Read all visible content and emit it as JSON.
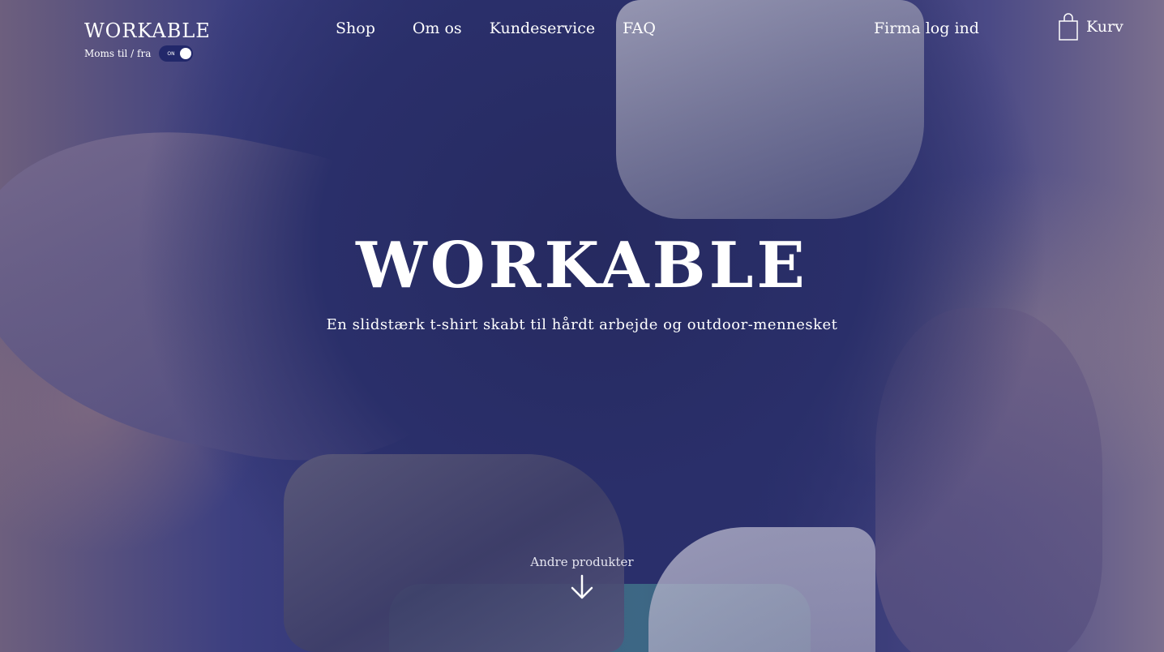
{
  "header": {
    "logo": "WORKABLE",
    "vat_label": "Moms til / fra",
    "vat_toggle_state": "ON",
    "nav": [
      {
        "label": "Shop"
      },
      {
        "label": "Om os"
      },
      {
        "label": "Kundeservice"
      },
      {
        "label": "FAQ"
      }
    ],
    "firm_login": "Firma log ind",
    "cart_label": "Kurv"
  },
  "hero": {
    "title": "WORKABLE",
    "subtitle": "En slidstærk t-shirt skabt til hårdt arbejde og outdoor-mennesket",
    "scroll_label": "Andre produkter"
  },
  "colors": {
    "overlay": "#2c3270",
    "toggle_bg": "#22286a",
    "text": "#ffffff"
  },
  "icons": [
    "shopping-bag-icon",
    "arrow-down-icon"
  ]
}
